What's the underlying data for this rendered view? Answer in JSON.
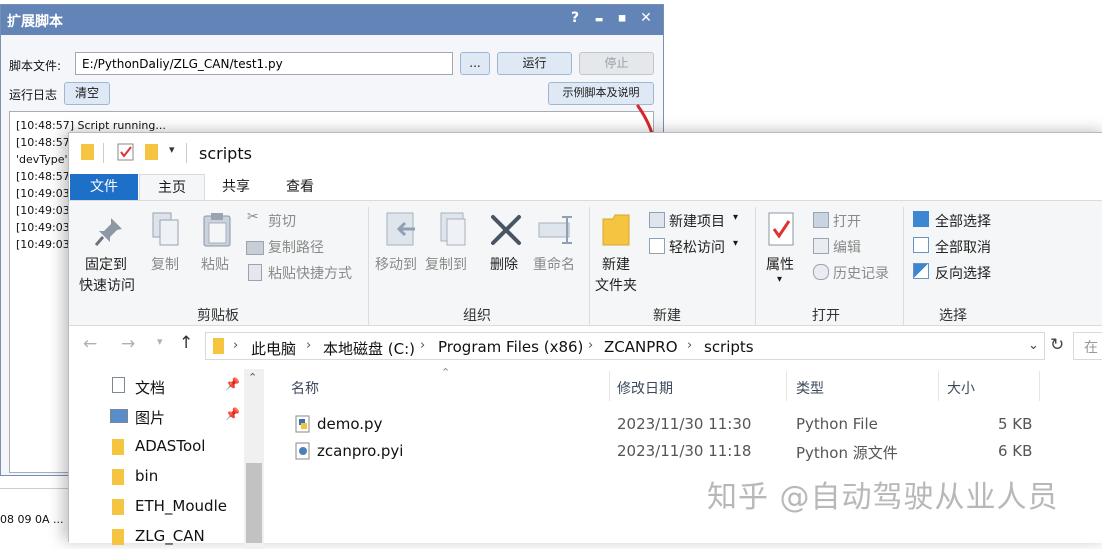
{
  "dialog": {
    "title": "扩展脚本",
    "title_buttons": [
      "?",
      "▬",
      "◼",
      "✕"
    ],
    "script_file_label": "脚本文件:",
    "script_path": "E:/PythonDaliy/ZLG_CAN/test1.py",
    "browse_label": "...",
    "run_label": "运行",
    "stop_label": "停止",
    "log_label": "运行日志",
    "clear_label": "清空",
    "examples_label": "示例脚本及说明",
    "log_lines": [
      "[10:48:57] Script running...",
      "[10:48:57]",
      "'devType'",
      "[10:48:57]",
      "[10:49:03]",
      "[10:49:03]",
      "[10:49:03]",
      "[10:49:03]"
    ],
    "bottom_text": "08 09 0A ..."
  },
  "explorer": {
    "window_title": "scripts",
    "tabs": [
      "文件",
      "主页",
      "共享",
      "查看"
    ],
    "active_tab": "主页",
    "ribbon": {
      "clipboard": {
        "group": "剪贴板",
        "pin_line1": "固定到",
        "pin_line2": "快速访问",
        "copy": "复制",
        "paste": "粘贴",
        "cut": "剪切",
        "copy_path": "复制路径",
        "paste_shortcut": "粘贴快捷方式"
      },
      "organize": {
        "group": "组织",
        "move_to": "移动到",
        "copy_to": "复制到",
        "delete": "删除",
        "rename": "重命名"
      },
      "new": {
        "group": "新建",
        "new_folder_line1": "新建",
        "new_folder_line2": "文件夹",
        "new_item": "新建项目",
        "easy_access": "轻松访问"
      },
      "open": {
        "group": "打开",
        "properties": "属性",
        "open": "打开",
        "edit": "编辑",
        "history": "历史记录"
      },
      "select": {
        "group": "选择",
        "select_all": "全部选择",
        "select_none": "全部取消",
        "invert": "反向选择"
      }
    },
    "breadcrumb": [
      "此电脑",
      "本地磁盘 (C:)",
      "Program Files (x86)",
      "ZCANPRO",
      "scripts"
    ],
    "search_hint": "在",
    "nav_items": [
      {
        "label": "文档",
        "icon": "document-icon",
        "pinned": true
      },
      {
        "label": "图片",
        "icon": "picture-icon",
        "pinned": true
      },
      {
        "label": "ADASTool",
        "icon": "folder-icon",
        "pinned": false
      },
      {
        "label": "bin",
        "icon": "folder-icon",
        "pinned": false
      },
      {
        "label": "ETH_Moudle",
        "icon": "folder-icon",
        "pinned": false
      },
      {
        "label": "ZLG_CAN",
        "icon": "folder-icon",
        "pinned": false
      }
    ],
    "columns": [
      "名称",
      "修改日期",
      "类型",
      "大小"
    ],
    "files": [
      {
        "name": "demo.py",
        "modified": "2023/11/30 11:30",
        "type": "Python File",
        "size": "5 KB"
      },
      {
        "name": "zcanpro.pyi",
        "modified": "2023/11/30 11:18",
        "type": "Python 源文件",
        "size": "6 KB"
      }
    ]
  },
  "watermark": "知乎 @自动驾驶从业人员",
  "colors": {
    "title_bar": "#6384b6",
    "file_tab": "#1e6fc7",
    "annotation_arrow": "#d9262b",
    "folder": "#f5c542"
  }
}
